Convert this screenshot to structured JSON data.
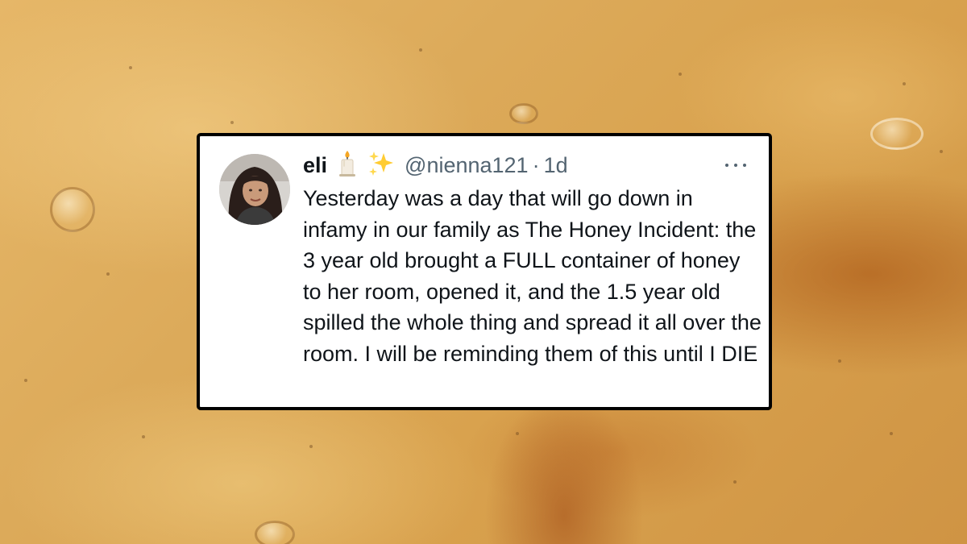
{
  "tweet": {
    "display_name": "eli",
    "emojis": [
      "candle-emoji",
      "sparkles-emoji"
    ],
    "handle": "@nienna121",
    "separator": "·",
    "timestamp": "1d",
    "more_icon": "more-horizontal-icon",
    "text": "Yesterday was a day that will go down in infamy in our family as The Honey Incident: the 3 year old brought a FULL container of honey to her room, opened it, and the 1.5 year old spilled the whole thing and spread it all over the room. I will be reminding them of this until I DIE"
  },
  "colors": {
    "text_primary": "#0f1419",
    "text_secondary": "#536471",
    "card_border": "#000000",
    "background_honey": "#dcaa5a"
  }
}
